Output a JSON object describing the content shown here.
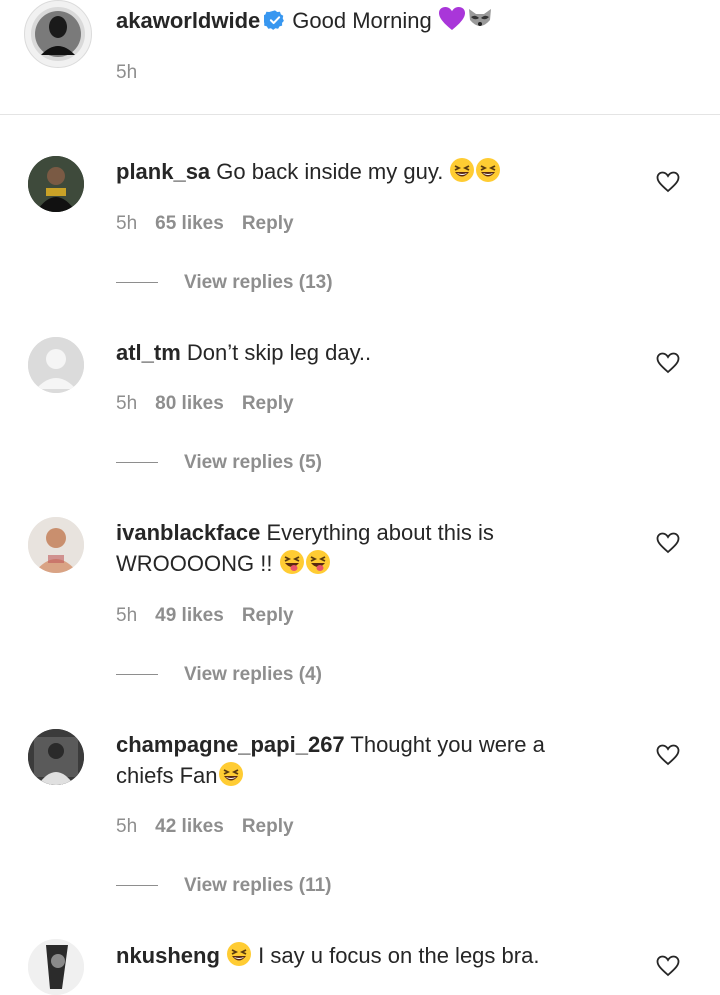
{
  "caption": {
    "username": "akaworldwide",
    "text": "Good Morning",
    "emojis": [
      "purple-heart-icon",
      "raccoon-icon"
    ],
    "time": "5h"
  },
  "comments": [
    {
      "username": "plank_sa",
      "line1": "Go back inside my guy.",
      "line2": "",
      "emojis": [
        "grinning-squinting-face-icon",
        "grinning-squinting-face-icon"
      ],
      "time": "5h",
      "likes": "65 likes",
      "reply": "Reply",
      "view_replies": "View replies (13)"
    },
    {
      "username": "atl_tm",
      "line1": "Don’t skip leg day..",
      "line2": "",
      "emojis": [],
      "time": "5h",
      "likes": "80 likes",
      "reply": "Reply",
      "view_replies": "View replies (5)"
    },
    {
      "username": "ivanblackface",
      "line1": "Everything about this is",
      "line2": "WROOOONG !!",
      "emojis": [
        "winking-tongue-face-icon",
        "winking-tongue-face-icon"
      ],
      "time": "5h",
      "likes": "49 likes",
      "reply": "Reply",
      "view_replies": "View replies (4)"
    },
    {
      "username": "champagne_papi_267",
      "line1": "Thought you were a",
      "line2": "chiefs Fan",
      "emojis": [
        "grinning-squinting-face-icon"
      ],
      "time": "5h",
      "likes": "42 likes",
      "reply": "Reply",
      "view_replies": "View replies (11)"
    },
    {
      "username": "nkusheng",
      "line1": "I say u focus on the legs bra.",
      "line2": "",
      "emojis": [
        "grinning-squinting-face-icon"
      ],
      "time": "",
      "likes": "",
      "reply": "",
      "view_replies": ""
    }
  ],
  "colors": {
    "primary_text": "#262626",
    "secondary_text": "#8e8e8e",
    "verified_blue": "#3897f0",
    "divider": "#e4e4e4"
  }
}
